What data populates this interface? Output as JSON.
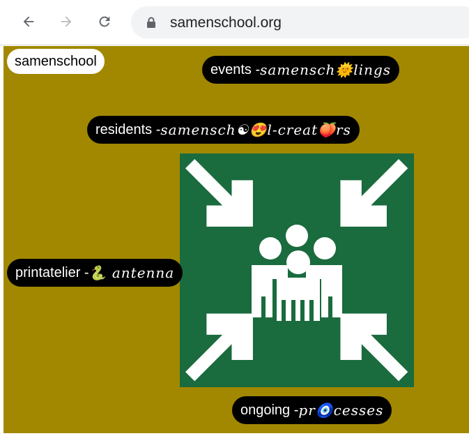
{
  "browser": {
    "url": "samenschool.org"
  },
  "page": {
    "home_label": "samenschool",
    "events": {
      "prefix": "events -",
      "fancy": "samensch🌞lings"
    },
    "residents": {
      "prefix": "residents - ",
      "fancy": "samensch☯😍l-creat🍑rs"
    },
    "printatelier": {
      "prefix": "printatelier - ",
      "fancy": "🐍 antenna"
    },
    "ongoing": {
      "prefix": "ongoing - ",
      "fancy": "pr🧿cesses"
    }
  },
  "colors": {
    "page_background": "#a28800",
    "pill_background": "#000000",
    "sign_green": "#1a6b3d"
  },
  "icons": [
    "back-arrow-icon",
    "forward-arrow-icon",
    "reload-icon",
    "lock-icon",
    "assembly-point-sign-icon"
  ]
}
